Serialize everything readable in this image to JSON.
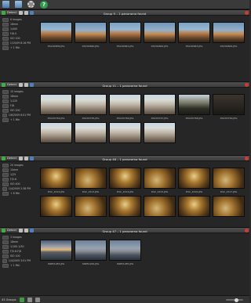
{
  "toolbar": {
    "icons": [
      "photos-icon",
      "folder-icon",
      "gear-icon",
      "help-icon"
    ],
    "help_label": "?"
  },
  "groups": [
    {
      "title": "Group 9 – 1 panorama found",
      "detect_label": "Detect",
      "info": [
        "6 images",
        "18mm",
        "1/400",
        "F/8.0",
        "ISO 100",
        "1/15/09 8:16 PM",
        "+ 1 Min"
      ],
      "thumbs": [
        {
          "caption": "DSC90839.JPG",
          "style": "sky1"
        },
        {
          "caption": "DSC90840.JPG",
          "style": "sky2"
        },
        {
          "caption": "DSC90841.JPG",
          "style": "sky1"
        },
        {
          "caption": "DSC90842.JPG",
          "style": "sky2"
        },
        {
          "caption": "DSC90843.JPG",
          "style": "sky1"
        },
        {
          "caption": "DSC90844.JPG",
          "style": "sky2"
        }
      ]
    },
    {
      "title": "Group 11 – 1 panorama found",
      "detect_label": "Detect",
      "info": [
        "10 images",
        "18mm",
        "1/125",
        "F/8",
        "ISO 200",
        "1/6/2009 6:01 PM",
        "+ 1 Min"
      ],
      "thumbs": [
        {
          "caption": "DSC93744.JPG",
          "style": "church"
        },
        {
          "caption": "DSC93745.JPG",
          "style": "church"
        },
        {
          "caption": "DSC93746.JPG",
          "style": "church"
        },
        {
          "caption": "DSC93747.JPG",
          "style": "church"
        },
        {
          "caption": "DSC93748.JPG",
          "style": "tree"
        },
        {
          "caption": "DSC93749.JPG",
          "style": "dark"
        },
        {
          "caption": "",
          "style": "church"
        },
        {
          "caption": "",
          "style": "church"
        },
        {
          "caption": "",
          "style": "church"
        },
        {
          "caption": "",
          "style": "church"
        }
      ]
    },
    {
      "title": "Group 46 – 1 panorama found",
      "detect_label": "Detect",
      "info": [
        "20 images",
        "10mm",
        "1/25",
        "F/5.6",
        "ISO 400",
        "1/4/2009 2:38 PM",
        "+ 8 Min"
      ],
      "thumbs": [
        {
          "caption": "DSC_4312.JPG",
          "style": "hall"
        },
        {
          "caption": "DSC_4313.JPG",
          "style": "hall2"
        },
        {
          "caption": "DSC_4314.JPG",
          "style": "hall"
        },
        {
          "caption": "DSC_4315.JPG",
          "style": "hall2"
        },
        {
          "caption": "DSC_4316.JPG",
          "style": "hall"
        },
        {
          "caption": "DSC_4317.JPG",
          "style": "hall2"
        },
        {
          "caption": "",
          "style": "hall"
        },
        {
          "caption": "",
          "style": "hall2"
        },
        {
          "caption": "",
          "style": "hall"
        },
        {
          "caption": "",
          "style": "hall2"
        },
        {
          "caption": "",
          "style": "hall"
        },
        {
          "caption": "",
          "style": "hall2"
        }
      ]
    },
    {
      "title": "Group 47 – 1 panorama found",
      "detect_label": "Detect",
      "info": [
        "3 images",
        "18mm",
        "1/100-1/50",
        "F/5.6-F/8",
        "ISO 100",
        "1/4/2009 3:01 PM",
        "+ 1 Min"
      ],
      "thumbs": [
        {
          "caption": "SN851283.JPG",
          "style": "sunset"
        },
        {
          "caption": "SN851284.JPG",
          "style": "sea"
        },
        {
          "caption": "SN851285.JPG",
          "style": "sea"
        }
      ]
    }
  ],
  "statusbar": {
    "groups_label": "43 Groups"
  }
}
